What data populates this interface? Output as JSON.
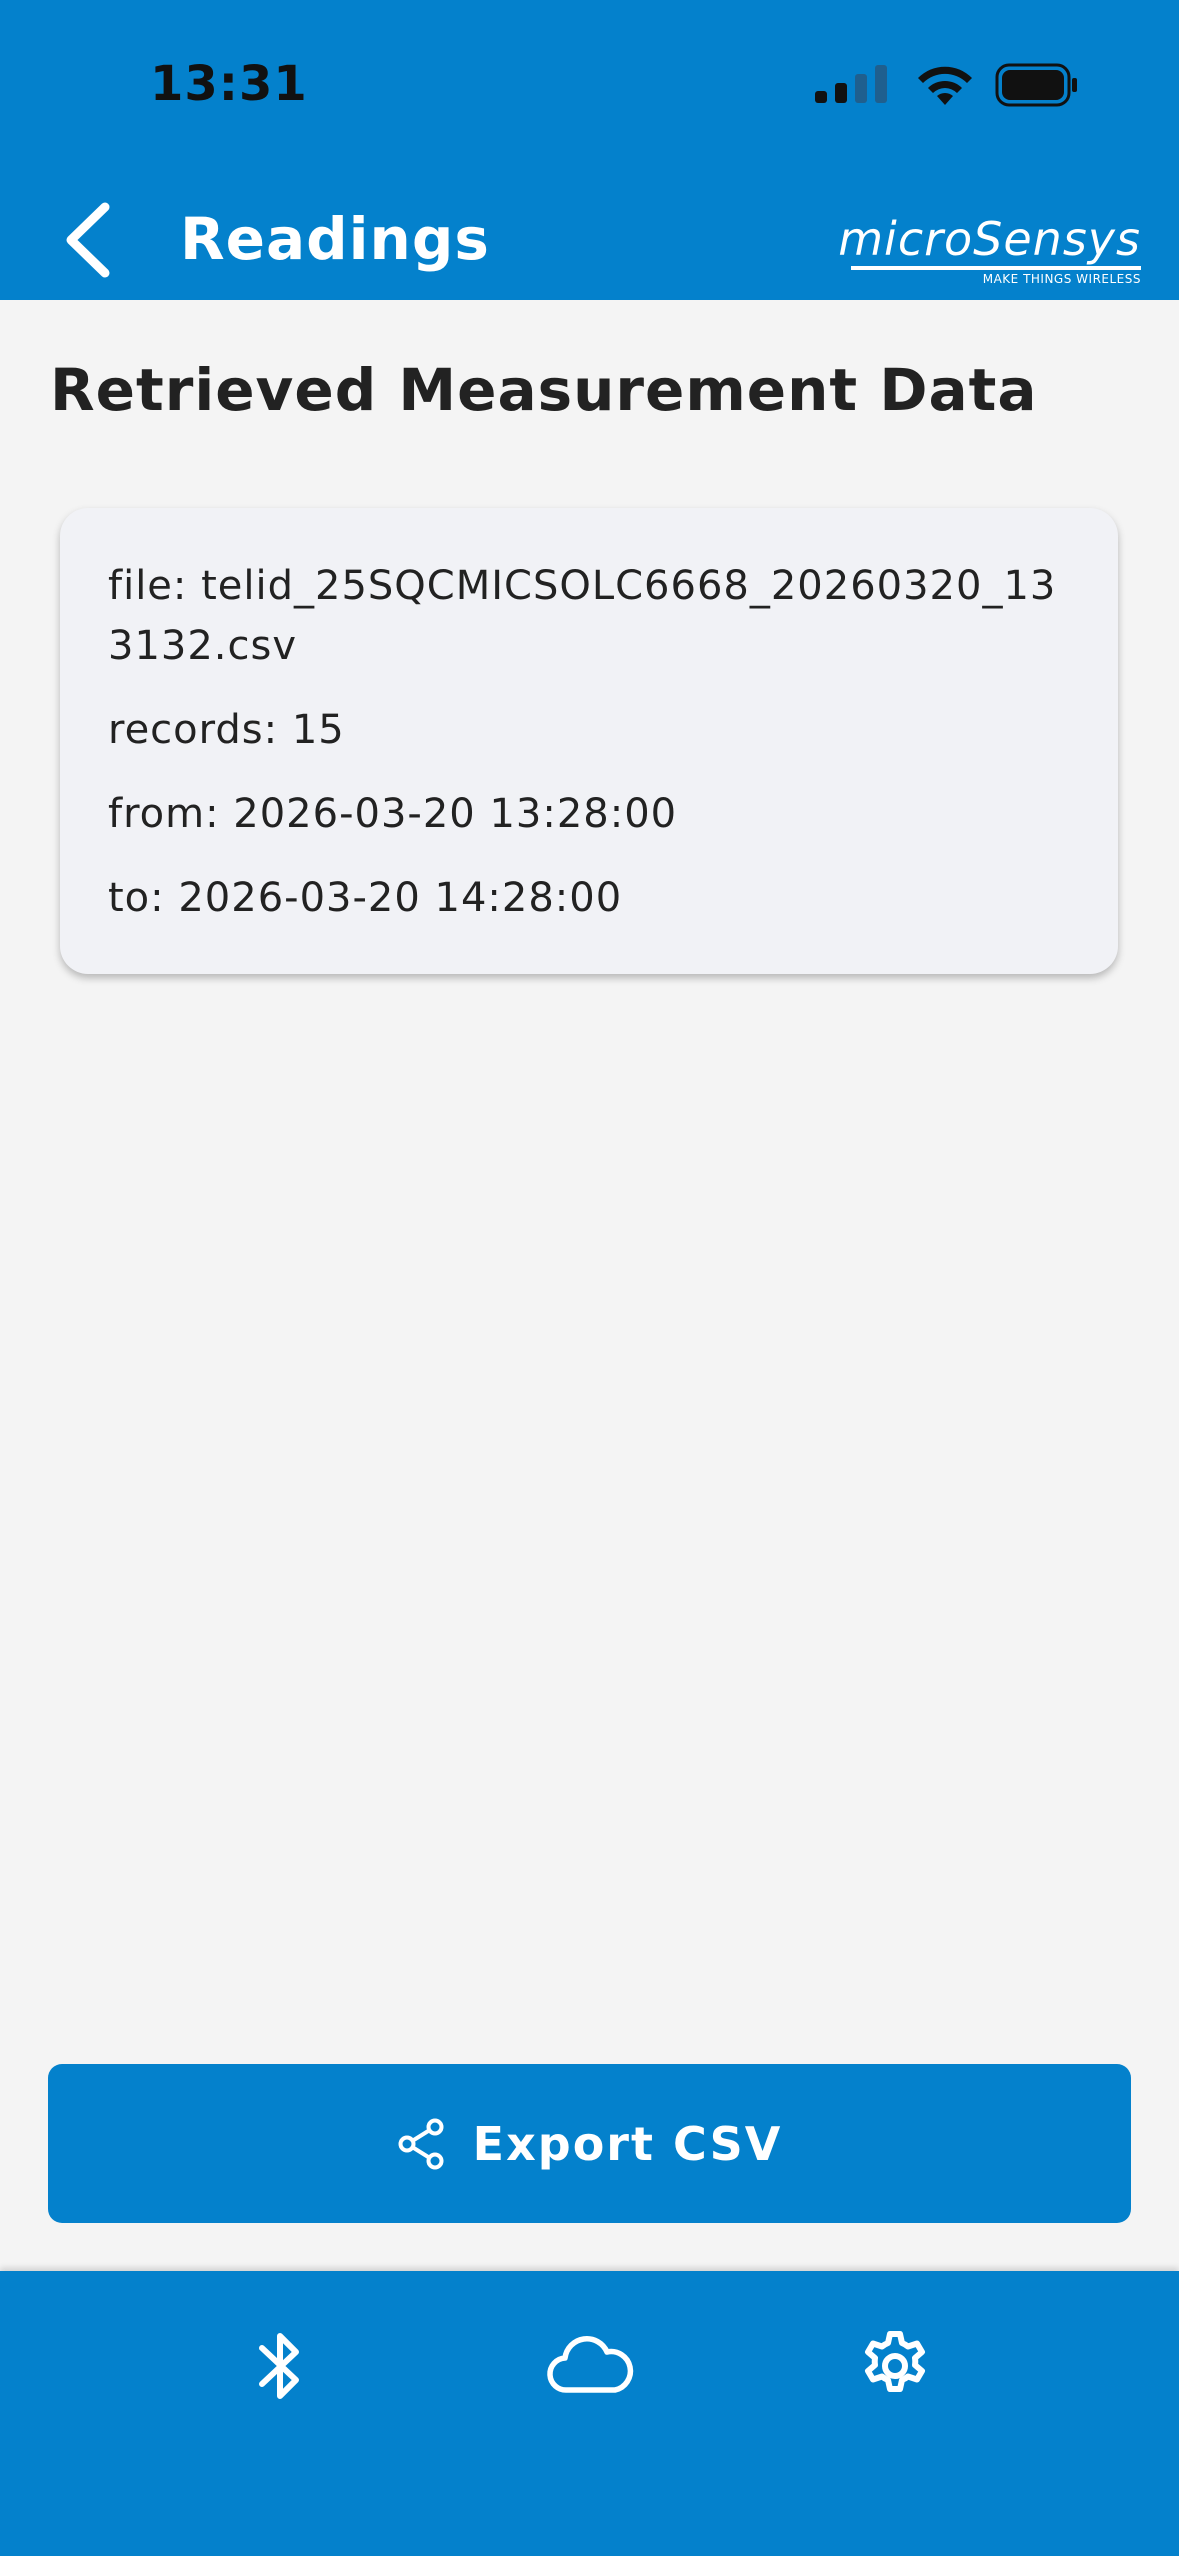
{
  "status_bar": {
    "time": "13:31"
  },
  "header": {
    "title": "Readings",
    "logo_text": "microSensys",
    "logo_tagline": "MAKE THINGS WIRELESS"
  },
  "main": {
    "heading": "Retrieved Measurement Data",
    "card": {
      "file_label": "file: ",
      "file_value": "telid_25SQCMICSOLC6668_20260320_133132.csv",
      "records_label": "records: ",
      "records_value": "15",
      "from_label": "from: ",
      "from_value": "2026-03-20 13:28:00",
      "to_label": "to: ",
      "to_value": "2026-03-20 14:28:00"
    },
    "export_button_label": "Export CSV"
  },
  "bottom_nav": {
    "items": [
      {
        "icon": "bluetooth-icon"
      },
      {
        "icon": "cloud-icon"
      },
      {
        "icon": "gear-icon"
      }
    ]
  },
  "colors": {
    "brand_blue": "#0481cc",
    "background": "#f4f4f4",
    "card_bg": "#f1f2f6"
  }
}
